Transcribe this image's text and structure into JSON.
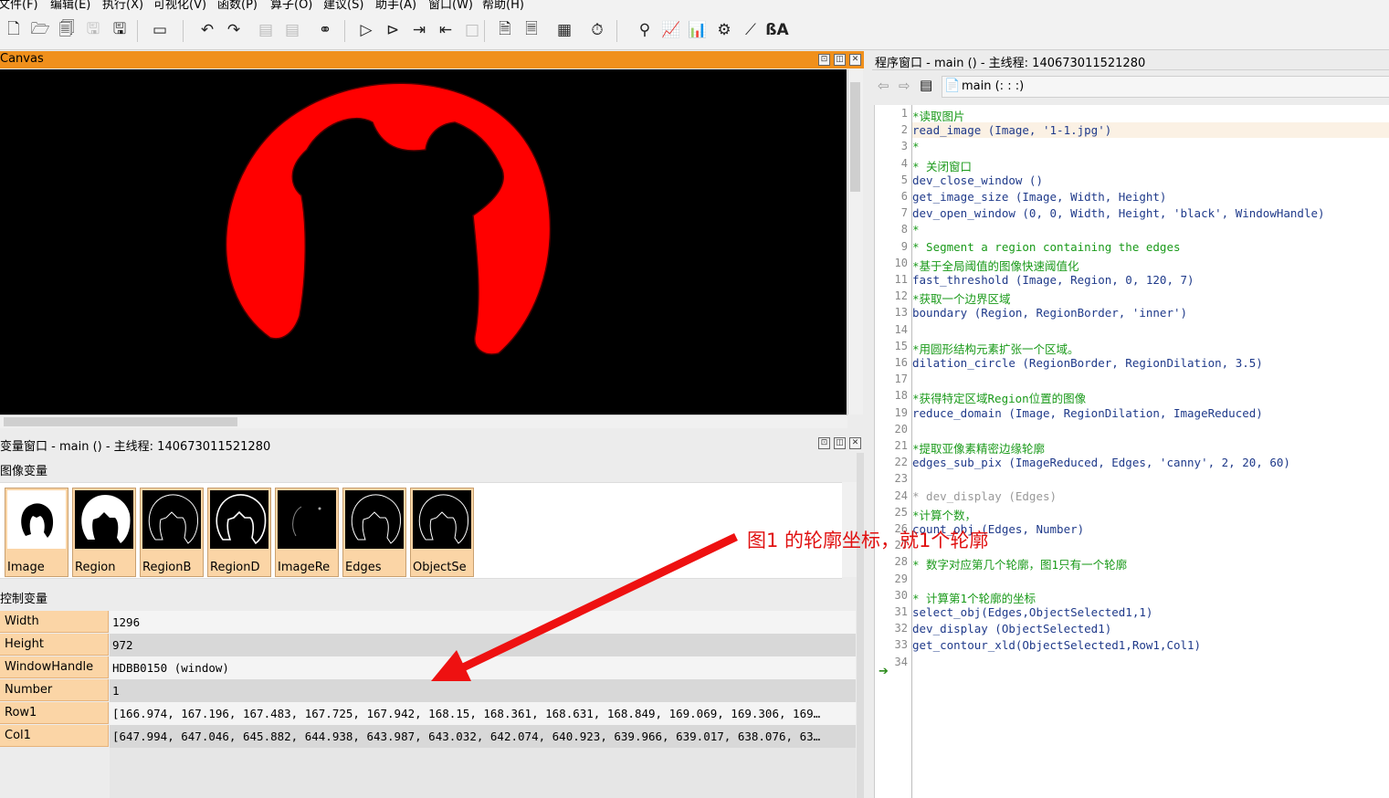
{
  "menu": [
    "文件(F)",
    "编辑(E)",
    "执行(X)",
    "可视化(V)",
    "函数(P)",
    "算子(O)",
    "建议(S)",
    "助手(A)",
    "窗口(W)",
    "帮助(H)"
  ],
  "toolbar_icons": [
    "new-file-icon",
    "open-icon",
    "browse-icon",
    "save-disabled-icon",
    "save-all-icon",
    "record-icon",
    "undo-icon",
    "redo-icon",
    "cut-disabled-icon",
    "paste-disabled-icon",
    "find-icon",
    "run-icon",
    "step-over-icon",
    "step-forward-icon",
    "step-back-icon",
    "stop-icon",
    "insert-icon",
    "print-icon",
    "activate-icon",
    "profiler-icon",
    "zoom-icon",
    "graph-icon",
    "histogram-icon",
    "gray-icon",
    "line-profile-icon",
    "ocr-icon"
  ],
  "canvas": {
    "title": "Canvas"
  },
  "variable_window": {
    "title": "变量窗口 - main () - 主线程: 140673011521280",
    "image_section": "图像变量",
    "images": [
      "Image",
      "Region",
      "RegionB",
      "RegionD",
      "ImageRe",
      "Edges",
      "ObjectSe"
    ],
    "control_section": "控制变量",
    "controls": [
      {
        "name": "Width",
        "value": "1296"
      },
      {
        "name": "Height",
        "value": "972"
      },
      {
        "name": "WindowHandle",
        "value": "HDBB0150 (window)"
      },
      {
        "name": "Number",
        "value": "1"
      },
      {
        "name": "Row1",
        "value": "[166.974, 167.196, 167.483, 167.725, 167.942, 168.15, 168.361, 168.631, 168.849, 169.069, 169.306, 169…"
      },
      {
        "name": "Col1",
        "value": "[647.994, 647.046, 645.882, 644.938, 643.987, 643.032, 642.074, 640.923, 639.966, 639.017, 638.076, 63…"
      }
    ]
  },
  "program_window": {
    "title": "程序窗口 - main () - 主线程: 140673011521280",
    "procedure": "main (: : :)",
    "lines": [
      {
        "n": "1",
        "text": "*读取图片",
        "kind": "comment"
      },
      {
        "n": "2",
        "text": "read_image (Image, '1-1.jpg')",
        "kind": "code"
      },
      {
        "n": "3",
        "text": "*",
        "kind": "comment"
      },
      {
        "n": "4",
        "text": "* 关闭窗口",
        "kind": "comment"
      },
      {
        "n": "5",
        "text": "dev_close_window ()",
        "kind": "code"
      },
      {
        "n": "6",
        "text": "get_image_size (Image, Width, Height)",
        "kind": "code"
      },
      {
        "n": "7",
        "text": "dev_open_window (0, 0, Width, Height, 'black', WindowHandle)",
        "kind": "code"
      },
      {
        "n": "8",
        "text": "*",
        "kind": "comment"
      },
      {
        "n": "9",
        "text": "* Segment a region containing the edges",
        "kind": "comment"
      },
      {
        "n": "10",
        "text": "*基于全局阈值的图像快速阈值化",
        "kind": "comment"
      },
      {
        "n": "11",
        "text": "fast_threshold (Image, Region, 0, 120, 7)",
        "kind": "code"
      },
      {
        "n": "12",
        "text": "*获取一个边界区域",
        "kind": "comment"
      },
      {
        "n": "13",
        "text": "boundary (Region, RegionBorder, 'inner')",
        "kind": "code"
      },
      {
        "n": "14",
        "text": "",
        "kind": "code"
      },
      {
        "n": "15",
        "text": "*用圆形结构元素扩张一个区域。",
        "kind": "comment"
      },
      {
        "n": "16",
        "text": "dilation_circle (RegionBorder, RegionDilation, 3.5)",
        "kind": "code"
      },
      {
        "n": "17",
        "text": "",
        "kind": "code"
      },
      {
        "n": "18",
        "text": "*获得特定区域Region位置的图像",
        "kind": "comment"
      },
      {
        "n": "19",
        "text": "reduce_domain (Image, RegionDilation, ImageReduced)",
        "kind": "code"
      },
      {
        "n": "20",
        "text": "",
        "kind": "code"
      },
      {
        "n": "21",
        "text": "*提取亚像素精密边缘轮廓",
        "kind": "comment"
      },
      {
        "n": "22",
        "text": "edges_sub_pix (ImageReduced, Edges, 'canny', 2, 20, 60)",
        "kind": "code"
      },
      {
        "n": "23",
        "text": "",
        "kind": "code"
      },
      {
        "n": "24",
        "text": "* dev_display (Edges)",
        "kind": "disabled"
      },
      {
        "n": "25",
        "text": "*计算个数，",
        "kind": "comment"
      },
      {
        "n": "26",
        "text": "count_obj (Edges, Number)",
        "kind": "code"
      },
      {
        "n": "27",
        "text": "",
        "kind": "code"
      },
      {
        "n": "28",
        "text": "* 数字对应第几个轮廓，图1只有一个轮廓",
        "kind": "comment"
      },
      {
        "n": "29",
        "text": "",
        "kind": "code"
      },
      {
        "n": "30",
        "text": "* 计算第1个轮廓的坐标",
        "kind": "comment"
      },
      {
        "n": "31",
        "text": "select_obj(Edges,ObjectSelected1,1)",
        "kind": "code"
      },
      {
        "n": "32",
        "text": "dev_display (ObjectSelected1)",
        "kind": "code"
      },
      {
        "n": "33",
        "text": "get_contour_xld(ObjectSelected1,Row1,Col1)",
        "kind": "code"
      },
      {
        "n": "34",
        "text": "",
        "kind": "code"
      }
    ]
  },
  "annotation": {
    "text": "图1 的轮廓坐标，就1个轮廓",
    "color": "#e01010"
  },
  "colors": {
    "canvas_title": "#f0901c",
    "shape": "#ff0000",
    "variable_key": "#fbd5a6"
  }
}
